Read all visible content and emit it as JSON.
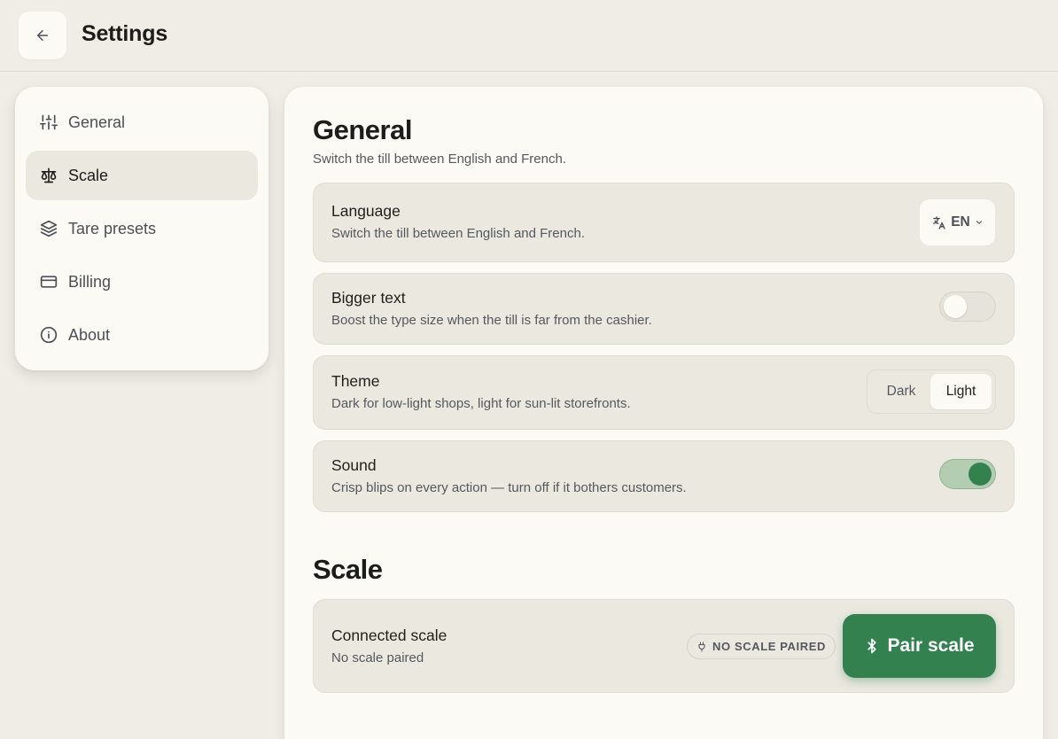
{
  "header": {
    "title": "Settings"
  },
  "sidebar": {
    "items": [
      {
        "label": "General",
        "icon": "sliders-icon"
      },
      {
        "label": "Scale",
        "icon": "scale-icon",
        "active": true
      },
      {
        "label": "Tare presets",
        "icon": "layers-icon"
      },
      {
        "label": "Billing",
        "icon": "credit-card-icon"
      },
      {
        "label": "About",
        "icon": "info-icon"
      }
    ]
  },
  "general": {
    "title": "General",
    "subtitle": "Switch the till between English and French.",
    "language": {
      "title": "Language",
      "desc": "Switch the till between English and French.",
      "value": "EN"
    },
    "bigger_text": {
      "title": "Bigger text",
      "desc": "Boost the type size when the till is far from the cashier.",
      "enabled": false
    },
    "theme": {
      "title": "Theme",
      "desc": "Dark for low-light shops, light for sun-lit storefronts.",
      "options": [
        "Dark",
        "Light"
      ],
      "selected": "Light"
    },
    "sound": {
      "title": "Sound",
      "desc": "Crisp blips on every action — turn off if it bothers customers.",
      "enabled": true
    }
  },
  "scale": {
    "title": "Scale",
    "connected": {
      "title": "Connected scale",
      "desc": "No scale paired",
      "badge": "NO SCALE PAIRED",
      "button": "Pair scale"
    }
  },
  "colors": {
    "accent": "#33814f",
    "background": "#efede6",
    "card": "#fbfaf5",
    "row": "#ebe8e0"
  }
}
